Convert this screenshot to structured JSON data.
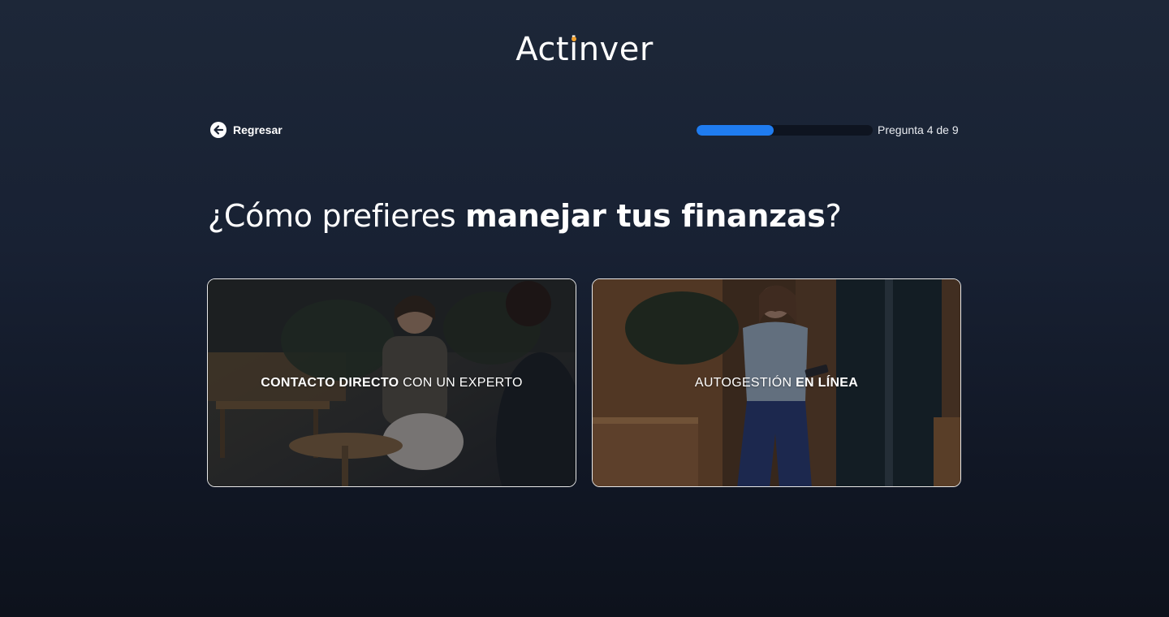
{
  "header": {
    "logo_part1": "Act",
    "logo_i": "i",
    "logo_part2": "nver",
    "logo_dot_color": "#f3a230"
  },
  "nav": {
    "back_label": "Regresar",
    "back_icon": "arrow-left-circle-icon"
  },
  "progress": {
    "label": "Pregunta 4 de 9",
    "fraction": 0.44,
    "color": "#1f7cf0"
  },
  "question": {
    "prefix": "¿Cómo prefieres ",
    "emphasis": "manejar tus finanzas",
    "suffix": "?"
  },
  "options": [
    {
      "label_bold": "CONTACTO DIRECTO",
      "label_rest": " CON UN EXPERTO",
      "image": "two women talking in a café"
    },
    {
      "label_rest": "AUTOGESTIÓN ",
      "label_bold": "EN LÍNEA",
      "image": "woman walking while using her phone"
    }
  ]
}
